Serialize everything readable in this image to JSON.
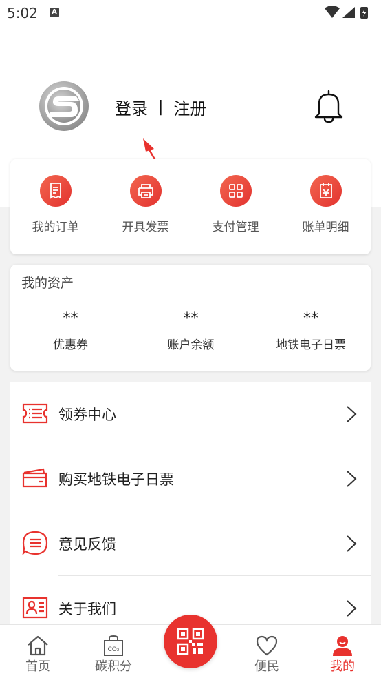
{
  "status_bar": {
    "time": "5:02",
    "notification_badge": "A"
  },
  "header": {
    "login_label": "登录",
    "separator": "|",
    "register_label": "注册"
  },
  "quick_actions": [
    {
      "label": "我的订单",
      "icon": "receipt-icon"
    },
    {
      "label": "开具发票",
      "icon": "printer-icon"
    },
    {
      "label": "支付管理",
      "icon": "grid-icon"
    },
    {
      "label": "账单明细",
      "icon": "bill-icon"
    }
  ],
  "assets": {
    "title": "我的资产",
    "items": [
      {
        "value": "**",
        "label": "优惠券"
      },
      {
        "value": "**",
        "label": "账户余额"
      },
      {
        "value": "**",
        "label": "地铁电子日票"
      }
    ]
  },
  "menu": [
    {
      "label": "领券中心",
      "icon": "coupon-icon"
    },
    {
      "label": "购买地铁电子日票",
      "icon": "card-icon"
    },
    {
      "label": "意见反馈",
      "icon": "feedback-icon"
    },
    {
      "label": "关于我们",
      "icon": "id-card-icon"
    }
  ],
  "bottom_nav": {
    "home": "首页",
    "carbon": "碳积分",
    "service": "便民",
    "mine": "我的",
    "carbon_icon_text": "CO₂"
  },
  "colors": {
    "accent": "#e8322e",
    "background": "#f2f2f2"
  }
}
